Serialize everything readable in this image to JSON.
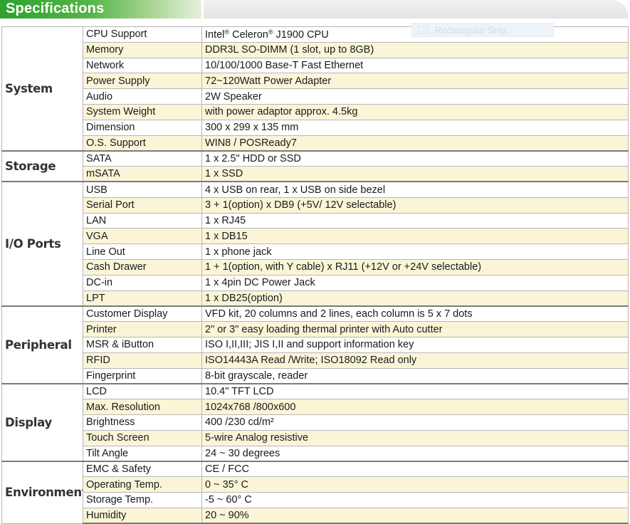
{
  "title": "Specifications",
  "overlay": {
    "label": "Rectangular Snip"
  },
  "sections": [
    {
      "name": "System",
      "rows": [
        {
          "label": "CPU Support",
          "value_parts": [
            "Intel",
            "®",
            " Celeron",
            "®",
            " J1900 CPU"
          ]
        },
        {
          "label": "Memory",
          "value": "DDR3L SO-DIMM (1 slot, up to 8GB)"
        },
        {
          "label": "Network",
          "value": "10/100/1000 Base-T Fast Ethernet"
        },
        {
          "label": "Power Supply",
          "value": "72~120Watt Power Adapter"
        },
        {
          "label": "Audio",
          "value": "2W Speaker"
        },
        {
          "label": "System Weight",
          "value": "with power adaptor approx. 4.5kg"
        },
        {
          "label": "Dimension",
          "value": "300 x 299 x 135 mm"
        },
        {
          "label": "O.S. Support",
          "value": "WIN8 / POSReady7"
        }
      ]
    },
    {
      "name": "Storage",
      "rows": [
        {
          "label": "SATA",
          "value": "1 x 2.5\" HDD or SSD"
        },
        {
          "label": "mSATA",
          "value": "1 x SSD"
        }
      ]
    },
    {
      "name": "I/O Ports",
      "rows": [
        {
          "label": "USB",
          "value": "4 x USB on rear, 1 x USB on side bezel"
        },
        {
          "label": "Serial Port",
          "value": "3 + 1(option) x DB9 (+5V/ 12V selectable)"
        },
        {
          "label": "LAN",
          "value": "1 x RJ45"
        },
        {
          "label": "VGA",
          "value": "1 x DB15"
        },
        {
          "label": "Line Out",
          "value": "1 x phone jack"
        },
        {
          "label": "Cash Drawer",
          "value": "1 + 1(option, with Y cable) x RJ11 (+12V or +24V selectable)"
        },
        {
          "label": "DC-in",
          "value": "1 x 4pin DC Power Jack"
        },
        {
          "label": "LPT",
          "value": "1 x DB25(option)"
        }
      ]
    },
    {
      "name": "Peripheral",
      "rows": [
        {
          "label": "Customer Display",
          "value": "VFD kit, 20 columns and 2 lines, each column is 5 x 7 dots"
        },
        {
          "label": "Printer",
          "value": "2\" or 3\" easy loading thermal printer with Auto cutter"
        },
        {
          "label": "MSR & iButton",
          "value": "ISO I,II,III; JIS I,II and support information key"
        },
        {
          "label": "RFID",
          "value": "ISO14443A Read /Write; ISO18092 Read only"
        },
        {
          "label": "Fingerprint",
          "value": "8-bit grayscale, reader"
        }
      ]
    },
    {
      "name": "Display",
      "rows": [
        {
          "label": "LCD",
          "value": "10.4\" TFT LCD"
        },
        {
          "label": "Max. Resolution",
          "value": "1024x768 /800x600"
        },
        {
          "label": "Brightness",
          "value": "400 /230 cd/m²"
        },
        {
          "label": "Touch Screen",
          "value": "5-wire Analog resistive"
        },
        {
          "label": "Tilt Angle",
          "value": "24 ~ 30 degrees"
        }
      ]
    },
    {
      "name": "Environment",
      "rows": [
        {
          "label": "EMC & Safety",
          "value": "CE / FCC"
        },
        {
          "label": "Operating Temp.",
          "value": "0 ~ 35° C"
        },
        {
          "label": "Storage Temp.",
          "value": "-5 ~ 60° C"
        },
        {
          "label": "Humidity",
          "value": "20 ~ 90%"
        }
      ]
    }
  ]
}
